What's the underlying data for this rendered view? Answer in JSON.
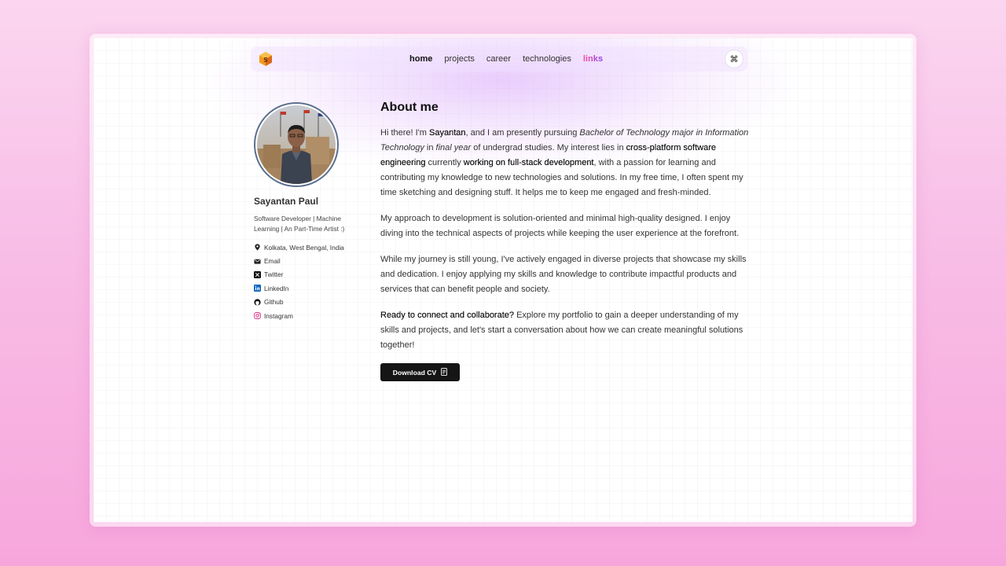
{
  "nav": {
    "items": [
      {
        "label": "home",
        "active": true
      },
      {
        "label": "projects",
        "active": false
      },
      {
        "label": "career",
        "active": false
      },
      {
        "label": "technologies",
        "active": false
      },
      {
        "label": "links",
        "active": false
      }
    ],
    "command_icon": "command-icon",
    "command_glyph": "⌘",
    "logo_icon": "cube-logo-icon"
  },
  "profile": {
    "name": "Sayantan Paul",
    "bio": "Software Developer | Machine Learning | An Part-Time Artist :)",
    "contacts": [
      {
        "label": "Kolkata, West Bengal, India",
        "icon": "location-pin-icon"
      },
      {
        "label": "Email",
        "icon": "mail-icon"
      },
      {
        "label": "Twitter",
        "icon": "x-twitter-icon"
      },
      {
        "label": "LinkedIn",
        "icon": "linkedin-icon"
      },
      {
        "label": "Github",
        "icon": "github-icon"
      },
      {
        "label": "Instagram",
        "icon": "instagram-icon"
      }
    ]
  },
  "about": {
    "heading": "About me",
    "p1": {
      "t1": "Hi there! I'm ",
      "b1": "Sayantan",
      "t2": ", and I am presently pursuing ",
      "i1": "Bachelor of Technology major in Information Technology",
      "t3": " in ",
      "i2": "final year",
      "t4": " of undergrad studies. My interest lies in ",
      "b2": "cross-platform software engineering",
      "t5": " currently ",
      "b3": "working on full-stack development",
      "t6": ", with a passion for learning and contributing my knowledge to new technologies and solutions. In my free time, I often spent my time sketching and designing stuff. It helps me to keep me engaged and fresh-minded."
    },
    "p2": "My approach to development is solution-oriented and minimal high-quality designed. I enjoy diving into the technical aspects of projects while keeping the user experience at the forefront.",
    "p3": "While my journey is still young, I've actively engaged in diverse projects that showcase my skills and dedication. I enjoy applying my skills and knowledge to contribute impactful products and services that can benefit people and society.",
    "p4": {
      "b1": "Ready to connect and collaborate?",
      "t1": " Explore my portfolio to gain a deeper understanding of my skills and projects, and let's start a conversation about how we can create meaningful solutions together!"
    },
    "cv_button": "Download CV",
    "cv_icon": "document-icon"
  },
  "colors": {
    "accent_gradient_start": "#ff4f9a",
    "accent_gradient_end": "#8a3ff0",
    "button_bg": "#151515",
    "page_bg": "#f8bde6"
  }
}
